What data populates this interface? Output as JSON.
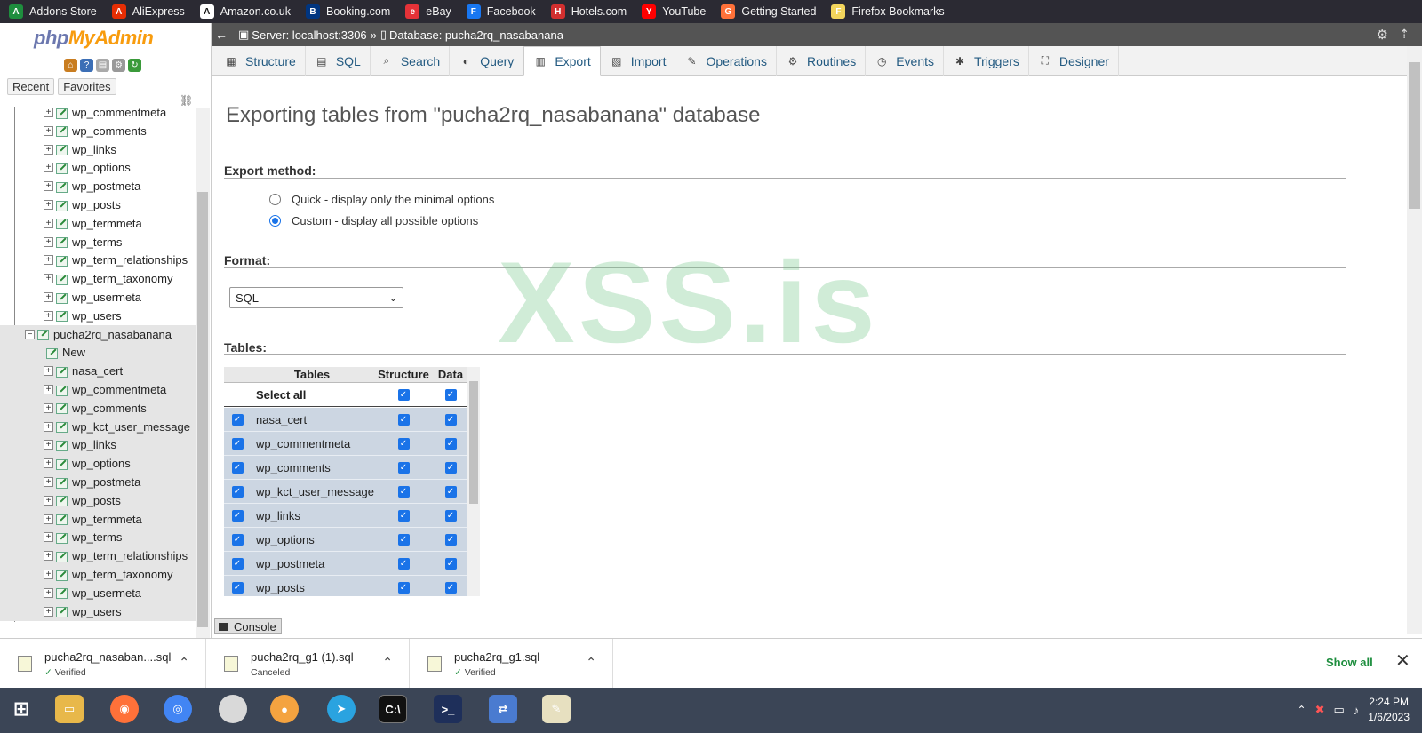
{
  "bookmarks": [
    {
      "label": "Addons Store",
      "icon": "addons-store-icon",
      "color": "#1e8e3e"
    },
    {
      "label": "AliExpress",
      "icon": "aliexpress-icon",
      "color": "#e62e04"
    },
    {
      "label": "Amazon.co.uk",
      "icon": "amazon-icon",
      "color": "#ffffff"
    },
    {
      "label": "Booking.com",
      "icon": "booking-icon",
      "color": "#003580"
    },
    {
      "label": "eBay",
      "icon": "ebay-icon",
      "color": "#e53238"
    },
    {
      "label": "Facebook",
      "icon": "facebook-icon",
      "color": "#1877f2"
    },
    {
      "label": "Hotels.com",
      "icon": "hotels-icon",
      "color": "#d32f2f"
    },
    {
      "label": "YouTube",
      "icon": "youtube-icon",
      "color": "#ff0000"
    },
    {
      "label": "Getting Started",
      "icon": "firefox-icon",
      "color": "#ff7139"
    },
    {
      "label": "Firefox Bookmarks",
      "icon": "folder-icon",
      "color": "#f2d55c"
    }
  ],
  "logo": {
    "part1": "php",
    "part2": "MyAdmin"
  },
  "nav": {
    "recent": "Recent",
    "favorites": "Favorites"
  },
  "tree": {
    "top_tables": [
      "wp_commentmeta",
      "wp_comments",
      "wp_links",
      "wp_options",
      "wp_postmeta",
      "wp_posts",
      "wp_termmeta",
      "wp_terms",
      "wp_term_relationships",
      "wp_term_taxonomy",
      "wp_usermeta",
      "wp_users"
    ],
    "db_name": "pucha2rq_nasabanana",
    "new_label": "New",
    "db_tables": [
      "nasa_cert",
      "wp_commentmeta",
      "wp_comments",
      "wp_kct_user_message",
      "wp_links",
      "wp_options",
      "wp_postmeta",
      "wp_posts",
      "wp_termmeta",
      "wp_terms",
      "wp_term_relationships",
      "wp_term_taxonomy",
      "wp_usermeta",
      "wp_users"
    ]
  },
  "header": {
    "server": "Server: localhost:3306",
    "sep": "»",
    "database": "Database: pucha2rq_nasabanana"
  },
  "tabs": [
    {
      "label": "Structure",
      "icon": "structure-icon"
    },
    {
      "label": "SQL",
      "icon": "sql-icon"
    },
    {
      "label": "Search",
      "icon": "search-icon"
    },
    {
      "label": "Query",
      "icon": "query-icon"
    },
    {
      "label": "Export",
      "icon": "export-icon",
      "active": true
    },
    {
      "label": "Import",
      "icon": "import-icon"
    },
    {
      "label": "Operations",
      "icon": "operations-icon"
    },
    {
      "label": "Routines",
      "icon": "routines-icon"
    },
    {
      "label": "Events",
      "icon": "events-icon"
    },
    {
      "label": "Triggers",
      "icon": "triggers-icon"
    },
    {
      "label": "Designer",
      "icon": "designer-icon"
    }
  ],
  "main": {
    "title": "Exporting tables from \"pucha2rq_nasabanana\" database",
    "export_method_label": "Export method:",
    "method_quick": "Quick - display only the minimal options",
    "method_custom": "Custom - display all possible options",
    "format_label": "Format:",
    "format_value": "SQL",
    "tables_label": "Tables:",
    "col_tables": "Tables",
    "col_structure": "Structure",
    "col_data": "Data",
    "select_all": "Select all",
    "table_rows": [
      "nasa_cert",
      "wp_commentmeta",
      "wp_comments",
      "wp_kct_user_message",
      "wp_links",
      "wp_options",
      "wp_postmeta",
      "wp_posts"
    ],
    "console": "Console"
  },
  "watermark": "XSS.is",
  "downloads": [
    {
      "file": "pucha2rq_nasaban....sql",
      "status": "Verified",
      "ok": true
    },
    {
      "file": "pucha2rq_g1 (1).sql",
      "status": "Canceled",
      "ok": false
    },
    {
      "file": "pucha2rq_g1.sql",
      "status": "Verified",
      "ok": true
    }
  ],
  "show_all": "Show all",
  "clock": {
    "time": "2:24 PM",
    "date": "1/6/2023"
  },
  "colors": {
    "accent": "#1a73e8",
    "link": "#235a81",
    "verified": "#1e8e3e"
  }
}
